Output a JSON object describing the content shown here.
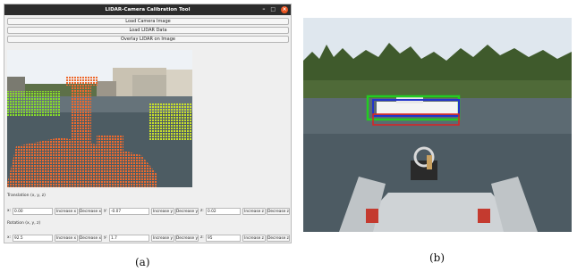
{
  "window": {
    "title": "LIDAR-Camera Calibration Tool",
    "controls": {
      "minimize": "–",
      "maximize": "□",
      "close": "×"
    },
    "buttons": {
      "load_camera": "Load Camera Image",
      "load_lidar": "Load LIDAR Data",
      "overlay": "Overlay LIDAR on Image"
    },
    "translation": {
      "section_label": "Translation (x, y, z)",
      "x_label": "x:",
      "x_value": "0.00",
      "x_inc": "Increase x",
      "x_dec": "Decrease x",
      "y_label": "y:",
      "y_value": "-0.07",
      "y_inc": "Increase y",
      "y_dec": "Decrease y",
      "z_label": "z:",
      "z_value": "0.02",
      "z_inc": "Increase z",
      "z_dec": "Decrease z"
    },
    "rotation": {
      "section_label": "Rotation (x, y, z)",
      "x_label": "x:",
      "x_value": "92.5",
      "x_inc": "Increase x",
      "x_dec": "Decrease x",
      "y_label": "y:",
      "y_value": "1.7",
      "y_inc": "Increase y",
      "y_dec": "Decrease y",
      "z_label": "z:",
      "z_value": "95",
      "z_inc": "Increase z",
      "z_dec": "Decrease z"
    }
  },
  "captions": {
    "a": "(a)",
    "b": "(b)"
  },
  "colors": {
    "titlebar": "#2c2c2c",
    "close_button": "#e95420",
    "lidar_orange": "#e8622a",
    "lidar_green": "#7ed321",
    "box_green": "#22cc22",
    "box_blue": "#2233cc",
    "box_red": "#dd2222"
  }
}
